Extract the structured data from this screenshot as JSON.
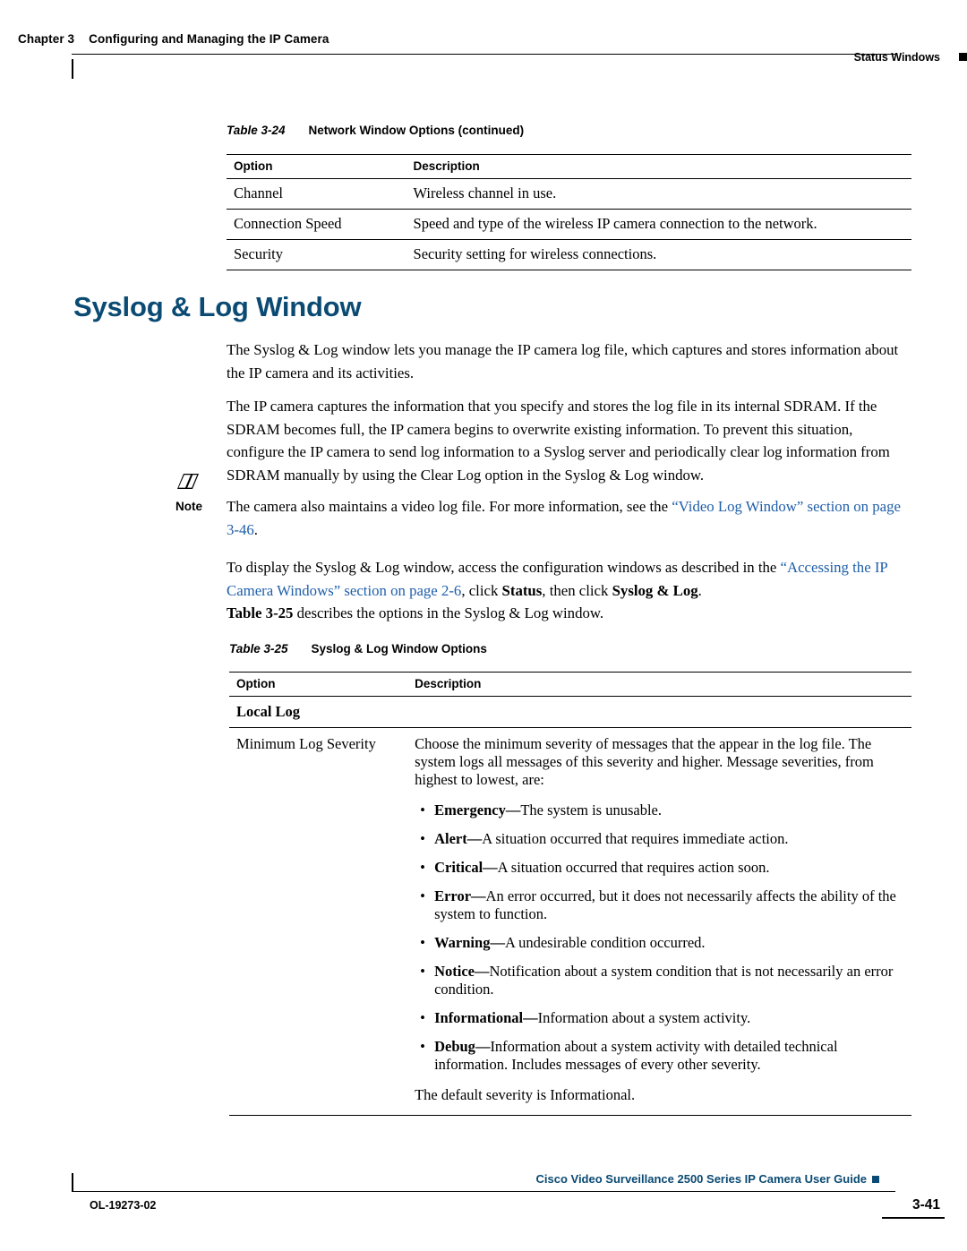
{
  "header": {
    "chapter": "Chapter 3",
    "chapter_title": "Configuring and Managing the IP Camera",
    "section": "Status Windows"
  },
  "table_24": {
    "caption_num": "Table 3-24",
    "caption_title": "Network Window Options (continued)",
    "columns": [
      "Option",
      "Description"
    ],
    "rows": [
      [
        "Channel",
        "Wireless channel in use."
      ],
      [
        "Connection Speed",
        "Speed and type of the wireless IP camera connection to the network."
      ],
      [
        "Security",
        "Security setting for wireless connections."
      ]
    ]
  },
  "heading": "Syslog & Log Window",
  "paragraphs": {
    "p1": "The Syslog & Log window lets you manage the IP camera log file, which captures and stores information about the IP camera and its activities.",
    "p2": "The IP camera captures the information that you specify and stores the log file in its internal SDRAM. If the SDRAM becomes full, the IP camera begins to overwrite existing information. To prevent this situation, configure the IP camera to send log information to a Syslog server and periodically clear log information from SDRAM manually by using the Clear Log option in the Syslog & Log window.",
    "note_label": "Note",
    "note_text_pre": "The camera also maintains a video log file. For more information, see the ",
    "note_link": "“Video Log Window” section on page 3-46",
    "note_text_post": ".",
    "p3_pre": "To display the Syslog & Log window, access the configuration windows as described in the ",
    "p3_link": "“Accessing the IP Camera Windows” section on page 2-6",
    "p3_mid": ", click ",
    "p3_bold1": "Status",
    "p3_mid2": ", then click ",
    "p3_bold2": "Syslog & Log",
    "p3_end": ".",
    "p4_bold": "Table 3-25",
    "p4_rest": " describes the options in the Syslog & Log window."
  },
  "table_25": {
    "caption_num": "Table 3-25",
    "caption_title": "Syslog & Log Window Options",
    "columns": [
      "Option",
      "Description"
    ],
    "section_row": "Local Log",
    "option": "Minimum Log Severity",
    "desc_intro": "Choose the minimum severity of messages that the appear in the log file. The system logs all messages of this severity and higher. Message severities, from highest to lowest, are:",
    "severities": [
      {
        "term": "Emergency",
        "dash": "—",
        "text": "The system is unusable."
      },
      {
        "term": "Alert",
        "dash": "—",
        "text": "A situation occurred that requires immediate action."
      },
      {
        "term": "Critical",
        "dash": "—",
        "text": "A situation occurred that requires action soon."
      },
      {
        "term": "Error",
        "dash": "—",
        "text": "An error occurred, but it does not necessarily affects the ability of the system to function."
      },
      {
        "term": "Warning",
        "dash": "—",
        "text": "A undesirable condition occurred."
      },
      {
        "term": "Notice",
        "dash": "—",
        "text": "Notification about a system condition that is not necessarily an error condition."
      },
      {
        "term": "Informational",
        "dash": "—",
        "text": "Information about a system activity."
      },
      {
        "term": "Debug",
        "dash": "—",
        "text": "Information about a system activity with detailed technical information. Includes messages of every other severity."
      }
    ],
    "desc_outro": "The default severity is Informational."
  },
  "footer": {
    "doc_id": "OL-19273-02",
    "title": "Cisco Video Surveillance 2500 Series IP Camera User Guide",
    "page": "3-41"
  },
  "colors": {
    "heading_blue": "#0a4a73",
    "link_blue": "#1f5fa9"
  }
}
